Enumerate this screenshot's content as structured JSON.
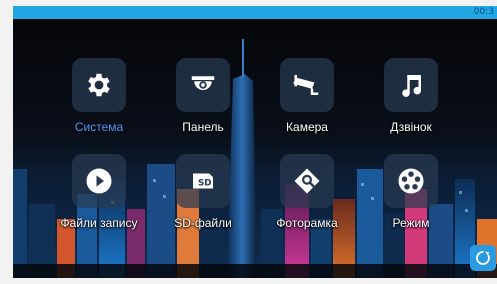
{
  "status_bar": {
    "clock": "00:3"
  },
  "menu": {
    "items": [
      {
        "label": "Система",
        "icon": "gear-icon",
        "selected": true
      },
      {
        "label": "Панель",
        "icon": "camera-dome-icon",
        "selected": false
      },
      {
        "label": "Камера",
        "icon": "cctv-camera-icon",
        "selected": false
      },
      {
        "label": "Дзвінок",
        "icon": "music-note-icon",
        "selected": false
      },
      {
        "label": "Файли запису",
        "icon": "play-icon",
        "selected": false
      },
      {
        "label": "SD-файли",
        "icon": "sd-card-icon",
        "selected": false
      },
      {
        "label": "Фоторамка",
        "icon": "photo-frame-icon",
        "selected": false
      },
      {
        "label": "Режим",
        "icon": "film-reel-icon",
        "selected": false
      }
    ]
  },
  "refresh": {
    "icon": "refresh-icon"
  },
  "colors": {
    "status_bar": "#1fa6e3",
    "selected_label": "#4f9cff",
    "label": "#ffffff",
    "tile_bg": "#283a52"
  }
}
